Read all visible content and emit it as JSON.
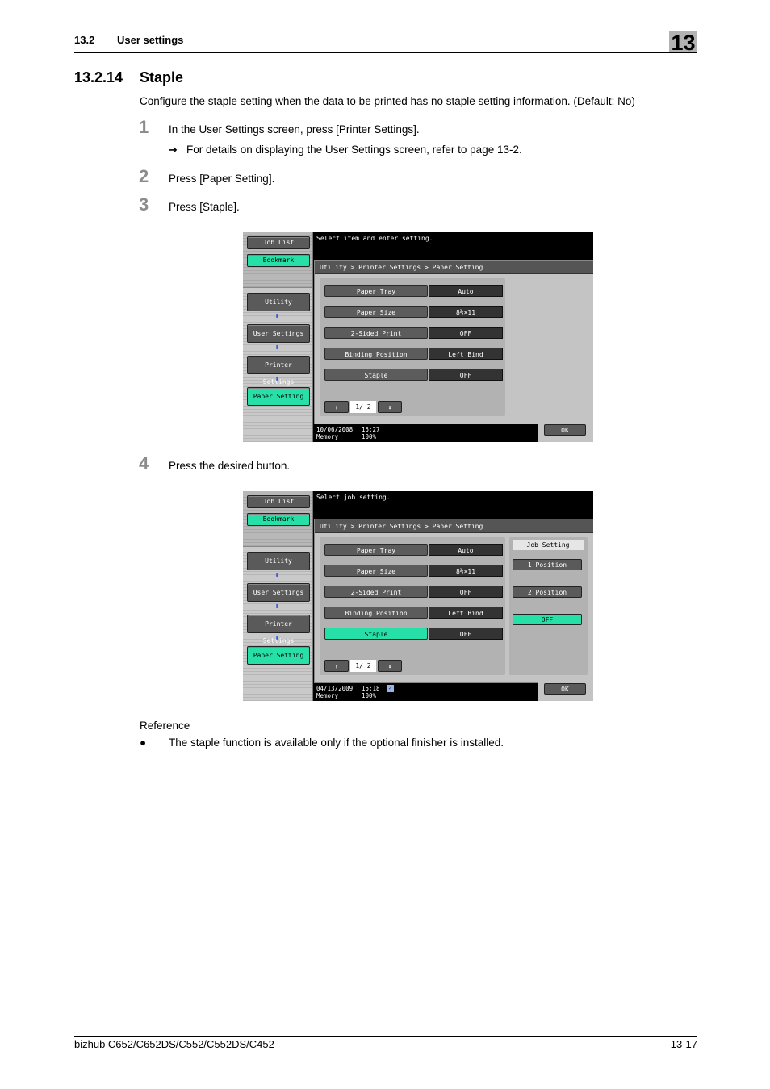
{
  "header": {
    "section_number": "13.2",
    "section_title": "User settings",
    "chapter_number": "13"
  },
  "heading": {
    "number": "13.2.14",
    "title": "Staple"
  },
  "intro": "Configure the staple setting when the data to be printed has no staple setting information. (Default: No)",
  "steps": [
    {
      "number": "1",
      "text": "In the User Settings screen, press [Printer Settings].",
      "sub_arrow": "➔",
      "sub_text": "For details on displaying the User Settings screen, refer to page 13-2."
    },
    {
      "number": "2",
      "text": "Press [Paper Setting]."
    },
    {
      "number": "3",
      "text": "Press [Staple]."
    },
    {
      "number": "4",
      "text": "Press the desired button."
    }
  ],
  "screens": [
    {
      "message": "Select item and enter setting.",
      "sidebar": {
        "job_list": "Job List",
        "bookmark": "Bookmark",
        "nav": [
          "Utility",
          "User Settings",
          "Printer Settings",
          "Paper Setting"
        ]
      },
      "breadcrumb": "Utility > Printer Settings > Paper Setting",
      "rows": [
        {
          "label": "Paper Tray",
          "value": "Auto"
        },
        {
          "label": "Paper Size",
          "value": "8½×11"
        },
        {
          "label": "2-Sided Print",
          "value": "OFF"
        },
        {
          "label": "Binding Position",
          "value": "Left Bind"
        },
        {
          "label": "Staple",
          "value": "OFF"
        }
      ],
      "pager": {
        "up": "⬆",
        "page": "1/ 2",
        "down": "⬇"
      },
      "ok": "OK",
      "status": {
        "date": "10/06/2008",
        "time": "15:27",
        "memory_label": "Memory",
        "memory_value": "100%"
      }
    },
    {
      "message": "Select job setting.",
      "sidebar": {
        "job_list": "Job List",
        "bookmark": "Bookmark",
        "nav": [
          "Utility",
          "User Settings",
          "Printer Settings",
          "Paper Setting"
        ]
      },
      "breadcrumb": "Utility > Printer Settings > Paper Setting",
      "rows": [
        {
          "label": "Paper Tray",
          "value": "Auto"
        },
        {
          "label": "Paper Size",
          "value": "8½×11"
        },
        {
          "label": "2-Sided Print",
          "value": "OFF"
        },
        {
          "label": "Binding Position",
          "value": "Left Bind"
        },
        {
          "label": "Staple",
          "value": "OFF"
        }
      ],
      "job_setting": {
        "title": "Job Setting",
        "options": [
          "1 Position",
          "2 Position",
          "OFF"
        ],
        "selected": "OFF"
      },
      "pager": {
        "up": "⬆",
        "page": "1/ 2",
        "down": "⬇"
      },
      "ok": "OK",
      "status": {
        "date": "04/13/2009",
        "time": "15:18",
        "memory_label": "Memory",
        "memory_value": "100%"
      }
    }
  ],
  "reference": {
    "label": "Reference",
    "bullet": "●",
    "items": [
      "The staple function is available only if the optional finisher is installed."
    ]
  },
  "footer": {
    "product": "bizhub C652/C652DS/C552/C552DS/C452",
    "page": "13-17"
  },
  "colors": {
    "selected_green": "#27e0a8",
    "step_number_gray": "#8c8c8c",
    "chapter_box_gray": "#b3b3b3"
  }
}
